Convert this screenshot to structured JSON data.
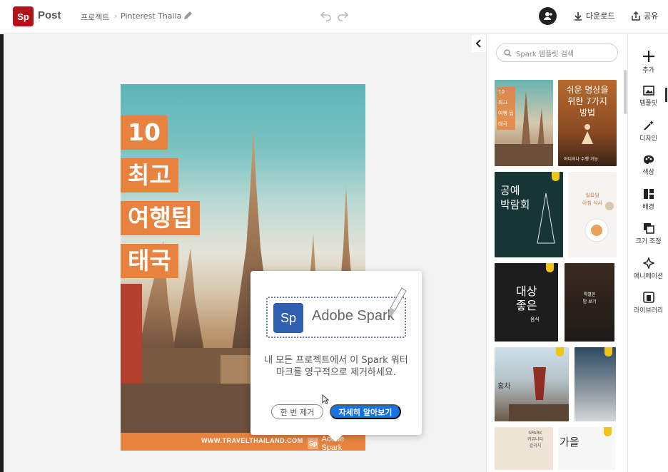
{
  "app": {
    "logo": "Sp",
    "name": "Post"
  },
  "breadcrumb": {
    "root": "프로젝트",
    "separator": "›",
    "project": "Pinterest Thailand t"
  },
  "header": {
    "download_label": "다운로드",
    "share_label": "공유"
  },
  "poster": {
    "title_lines": [
      "10",
      "최고",
      "여행팁",
      "태국"
    ],
    "url": "WWW.TRAVELTHAILAND.COM",
    "watermark_logo": "Sp",
    "watermark_text": "Adobe Spark"
  },
  "popup": {
    "logo": "Sp",
    "brand": "Adobe Spark",
    "message": "내 모든 프로젝트에서 이 Spark 워터마크를 영구적으로 제거하세요.",
    "remove_once_label": "한 번 제거",
    "learn_more_label": "자세히 알아보기"
  },
  "panel": {
    "search_placeholder": "Spark 템플릿 검색",
    "templates": [
      {
        "text": "10\n최고\n여행 팁\n태국",
        "caption": ""
      },
      {
        "text": "쉬운 명상을\n위한 7가지\n방법",
        "caption": "어디서나 수행 가능"
      },
      {
        "text": "공예\n박람회",
        "caption": ""
      },
      {
        "text": "일요일\n아침 식사",
        "caption": ""
      },
      {
        "text": "대상\n좋은",
        "caption": "음식"
      },
      {
        "text": "특별한\n밤 보기",
        "caption": ""
      },
      {
        "text": "홍차",
        "caption": ""
      },
      {
        "text": "",
        "caption": ""
      },
      {
        "text": "SPARK\n커뮤니티\n갈리지",
        "caption": ""
      },
      {
        "text": "가을",
        "caption": ""
      }
    ]
  },
  "rail": {
    "items": [
      {
        "label": "추가"
      },
      {
        "label": "템플릿"
      },
      {
        "label": "디자인"
      },
      {
        "label": "색상"
      },
      {
        "label": "배경"
      },
      {
        "label": "크기 조정"
      },
      {
        "label": "애니메이션"
      },
      {
        "label": "라이브러리"
      }
    ]
  },
  "colors": {
    "accent": "#1473e6",
    "poster_orange": "#e8823f",
    "logo_red": "#b3121a",
    "premium_badge": "#f0c419"
  }
}
